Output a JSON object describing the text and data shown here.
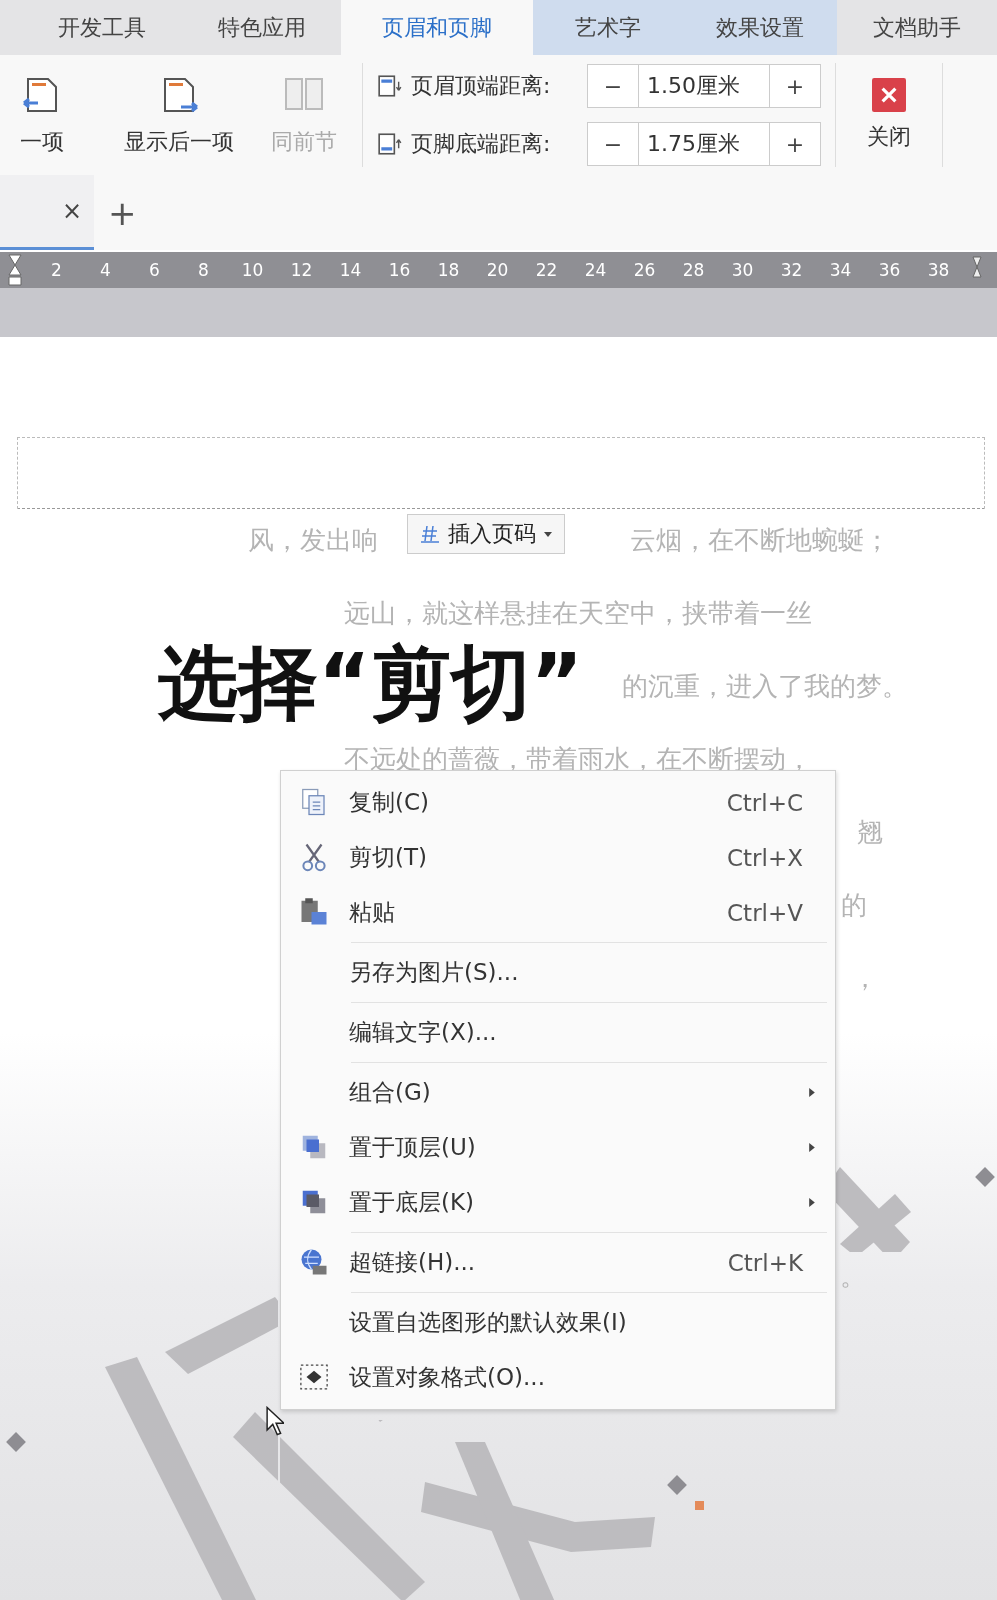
{
  "ribbon_tabs": [
    {
      "label": "开发工具",
      "selected": false,
      "contextual": false
    },
    {
      "label": "特色应用",
      "selected": false,
      "contextual": false
    },
    {
      "label": "页眉和页脚",
      "selected": true,
      "contextual": false
    },
    {
      "label": "艺术字",
      "selected": false,
      "contextual": true
    },
    {
      "label": "效果设置",
      "selected": false,
      "contextual": true
    },
    {
      "label": "文档助手",
      "selected": false,
      "contextual": false
    }
  ],
  "ribbon_buttons": [
    {
      "label": "一项",
      "disabled": false
    },
    {
      "label": "显示后一项",
      "disabled": false
    },
    {
      "label": "同前节",
      "disabled": true
    }
  ],
  "spinners": [
    {
      "label": "页眉顶端距离:",
      "minus": "−",
      "value": "1.50厘米",
      "plus": "+"
    },
    {
      "label": "页脚底端距离:",
      "minus": "−",
      "value": "1.75厘米",
      "plus": "+"
    }
  ],
  "close_button": {
    "label": "关闭"
  },
  "document_tab": {
    "close": "×",
    "add": "+"
  },
  "ruler": [
    "2",
    "4",
    "6",
    "8",
    "10",
    "12",
    "14",
    "16",
    "18",
    "20",
    "22",
    "24",
    "26",
    "28",
    "30",
    "32",
    "34",
    "36",
    "38"
  ],
  "document_lines": [
    [
      "风，发出响",
      "云烟，在不断地蜿蜒；"
    ],
    [
      "远山，就这样悬挂在天空中，挟带着一丝"
    ],
    [
      "的沉重，进入了我的梦。"
    ],
    [
      "不远处的蔷薇，带着雨水，在不断摆动，"
    ],
    [
      "翘"
    ],
    [
      "的"
    ],
    [
      "，"
    ],
    [
      "。"
    ]
  ],
  "insert_page_number": {
    "label": "插入页码"
  },
  "caption": "选择“剪切”",
  "context_menu": [
    {
      "kind": "item",
      "label": "复制(C)",
      "shortcut": "Ctrl+C",
      "submenu": false
    },
    {
      "kind": "item",
      "label": "剪切(T)",
      "shortcut": "Ctrl+X",
      "submenu": false
    },
    {
      "kind": "item",
      "label": "粘贴",
      "shortcut": "Ctrl+V",
      "submenu": false
    },
    {
      "kind": "separator"
    },
    {
      "kind": "item",
      "label": "另存为图片(S)...",
      "submenu": false
    },
    {
      "kind": "separator"
    },
    {
      "kind": "item",
      "label": "编辑文字(X)...",
      "submenu": false
    },
    {
      "kind": "separator"
    },
    {
      "kind": "item",
      "label": "组合(G)",
      "submenu": true
    },
    {
      "kind": "item",
      "label": "置于顶层(U)",
      "submenu": true
    },
    {
      "kind": "item",
      "label": "置于底层(K)",
      "submenu": true
    },
    {
      "kind": "separator"
    },
    {
      "kind": "item",
      "label": "超链接(H)...",
      "shortcut": "Ctrl+K",
      "submenu": false
    },
    {
      "kind": "separator"
    },
    {
      "kind": "item",
      "label": "设置自选图形的默认效果(I)",
      "submenu": false
    },
    {
      "kind": "item",
      "label": "设置对象格式(O)...",
      "submenu": false
    }
  ]
}
